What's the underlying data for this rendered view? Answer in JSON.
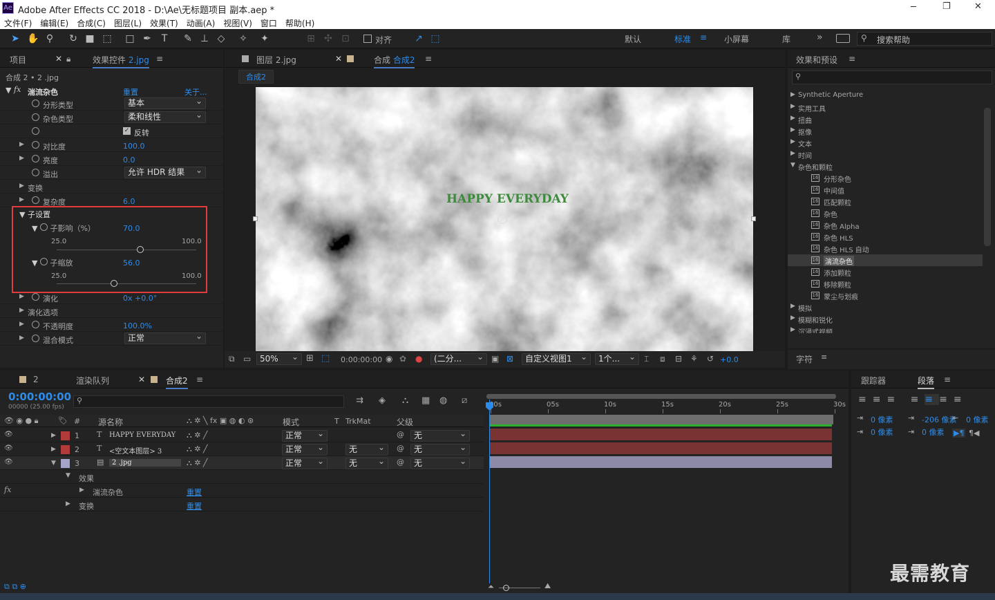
{
  "window": {
    "title": "Adobe After Effects CC 2018 - D:\\Ae\\无标题项目 副本.aep *",
    "logo": "Ae",
    "minimize": "─",
    "restore": "❐",
    "close": "✕"
  },
  "menu": [
    "文件(F)",
    "编辑(E)",
    "合成(C)",
    "图层(L)",
    "效果(T)",
    "动画(A)",
    "视图(V)",
    "窗口",
    "帮助(H)"
  ],
  "toolbar": {
    "align": "对齐",
    "workspaces": [
      "默认",
      "标准",
      "小屏幕",
      "库"
    ],
    "active_workspace": "标准",
    "more": "»",
    "search_placeholder": "搜索帮助"
  },
  "left_panel": {
    "tab_project": "项目",
    "tab_effects": "效果控件",
    "tab_effects_file": "2.jpg",
    "breadcrumb": "合成 2 • 2 .jpg",
    "effect": {
      "name": "湍流杂色",
      "reset": "重置",
      "about": "关于..."
    },
    "props": [
      {
        "label": "分形类型",
        "value": "基本",
        "type": "select"
      },
      {
        "label": "杂色类型",
        "value": "柔和线性",
        "type": "select"
      },
      {
        "label": "",
        "value": "反转",
        "type": "check"
      },
      {
        "label": "对比度",
        "value": "100.0",
        "type": "num"
      },
      {
        "label": "亮度",
        "value": "0.0",
        "type": "num"
      },
      {
        "label": "溢出",
        "value": "允许 HDR 结果",
        "type": "select"
      },
      {
        "label": "变换",
        "value": "",
        "type": "group"
      },
      {
        "label": "复杂度",
        "value": "6.0",
        "type": "num"
      }
    ],
    "sub_settings": {
      "label": "子设置",
      "influence_label": "子影响（%）",
      "influence": "70.0",
      "influence_min": "25.0",
      "influence_max": "100.0",
      "influence_frac": 0.6,
      "scale_label": "子缩放",
      "scale": "56.0",
      "scale_min": "25.0",
      "scale_max": "100.0",
      "scale_frac": 0.41
    },
    "props2": [
      {
        "label": "演化",
        "value": "0x +0.0°"
      },
      {
        "label": "演化选项",
        "value": ""
      },
      {
        "label": "不透明度",
        "value": "100.0%"
      },
      {
        "label": "混合模式",
        "value": "正常"
      }
    ]
  },
  "viewer": {
    "tab_layer": "图层",
    "tab_layer_file": "2.jpg",
    "tab_comp": "合成",
    "tab_comp_name": "合成2",
    "crumb": "合成2",
    "overlay_text": "HAPPY EVERYDAY",
    "zoom": "50%",
    "timecode": "0:00:00:00",
    "resolution": "(二分...",
    "view": "自定义视图1",
    "views": "1个...",
    "exposure": "+0.0"
  },
  "effects_panel": {
    "title": "效果和预设",
    "search_placeholder": "",
    "items": [
      {
        "label": "Synthetic Aperture",
        "level": 0,
        "arrow": "▶"
      },
      {
        "label": "实用工具",
        "level": 0,
        "arrow": "▶"
      },
      {
        "label": "扭曲",
        "level": 0,
        "arrow": "▶"
      },
      {
        "label": "抠像",
        "level": 0,
        "arrow": "▶"
      },
      {
        "label": "文本",
        "level": 0,
        "arrow": "▶"
      },
      {
        "label": "时间",
        "level": 0,
        "arrow": "▶"
      },
      {
        "label": "杂色和颗粒",
        "level": 0,
        "arrow": "▼"
      },
      {
        "label": "分形杂色",
        "level": 1,
        "arrow": ""
      },
      {
        "label": "中间值",
        "level": 1,
        "arrow": ""
      },
      {
        "label": "匹配颗粒",
        "level": 1,
        "arrow": ""
      },
      {
        "label": "杂色",
        "level": 1,
        "arrow": ""
      },
      {
        "label": "杂色 Alpha",
        "level": 1,
        "arrow": ""
      },
      {
        "label": "杂色 HLS",
        "level": 1,
        "arrow": ""
      },
      {
        "label": "杂色 HLS 自动",
        "level": 1,
        "arrow": ""
      },
      {
        "label": "湍流杂色",
        "level": 1,
        "arrow": ""
      },
      {
        "label": "添加颗粒",
        "level": 1,
        "arrow": ""
      },
      {
        "label": "移除颗粒",
        "level": 1,
        "arrow": ""
      },
      {
        "label": "蒙尘与划痕",
        "level": 1,
        "arrow": ""
      },
      {
        "label": "模拟",
        "level": 0,
        "arrow": "▶"
      },
      {
        "label": "模糊和锐化",
        "level": 0,
        "arrow": "▶"
      },
      {
        "label": "沉浸式视频",
        "level": 0,
        "arrow": "▶"
      }
    ],
    "char_title": "字符"
  },
  "timeline": {
    "tab1": "2",
    "tab2": "渲染队列",
    "tab3": "合成2",
    "timecode": "0:00:00:00",
    "fps": "00000 (25.00 fps)",
    "col_source": "源名称",
    "col_mode": "模式",
    "col_t": "T",
    "col_trkmat": "TrkMat",
    "col_parent": "父级",
    "col_num": "#",
    "ruler": [
      "00s",
      "05s",
      "10s",
      "15s",
      "20s",
      "25s",
      "30s"
    ],
    "layers": [
      {
        "num": "1",
        "icon": "T",
        "name": "HAPPY EVERYDAY",
        "mode": "正常",
        "trk": "",
        "parent": "无",
        "color": "#b13a3a"
      },
      {
        "num": "2",
        "icon": "T",
        "name": "<空文本图层> 3",
        "mode": "正常",
        "trk": "无",
        "parent": "无",
        "color": "#b13a3a"
      },
      {
        "num": "3",
        "icon": "img",
        "name": "2 .jpg",
        "mode": "正常",
        "trk": "无",
        "parent": "无",
        "color": "#a4a4c8"
      }
    ],
    "effects_label": "效果",
    "effect_name": "湍流杂色",
    "reset": "重置",
    "transform": "变换"
  },
  "right_bottom": {
    "tab_tracker": "跟踪器",
    "tab_para": "段落",
    "indent1": "0 像素",
    "indent2": "-206 像素",
    "indent3": "0 像素",
    "indent4": "0 像素",
    "indent5": "0 像素"
  },
  "watermark": "最需教育"
}
